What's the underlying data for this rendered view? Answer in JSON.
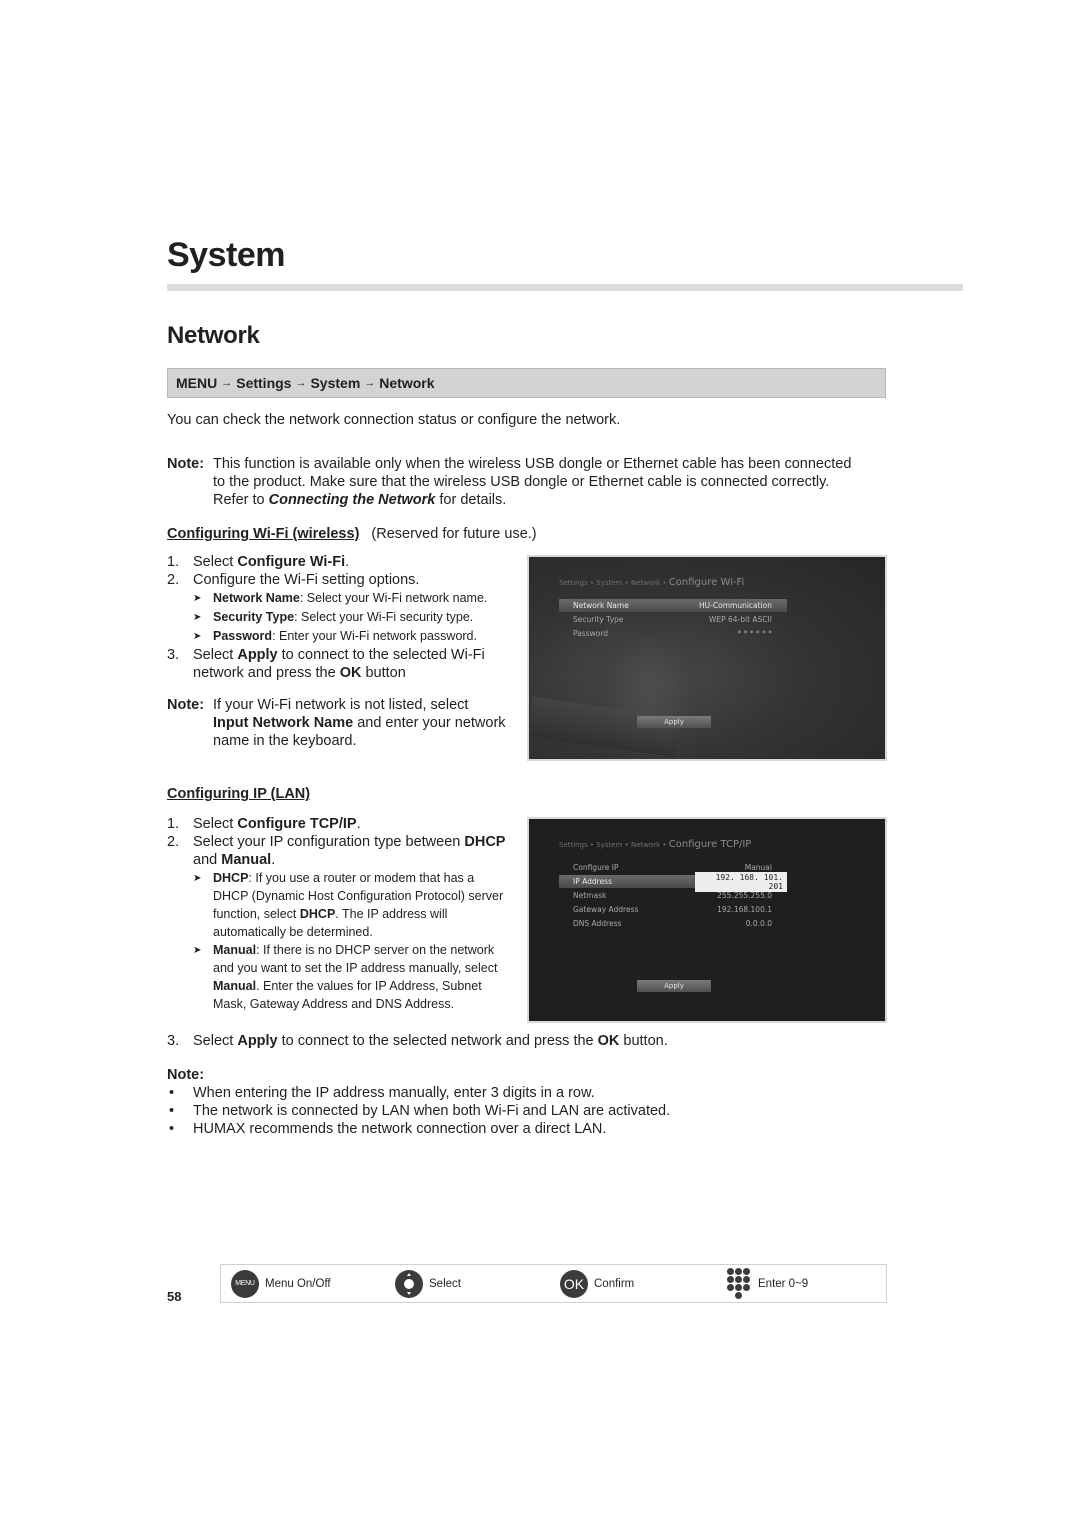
{
  "page": {
    "chapter_title": "System",
    "section_title": "Network",
    "page_number": "58"
  },
  "breadcrumb": {
    "items": [
      "MENU",
      "Settings",
      "System",
      "Network"
    ],
    "separator": "→"
  },
  "intro": "You can check the network connection status or configure the network.",
  "note1": {
    "label": "Note:",
    "line1": "This function is available only when the wireless USB dongle or Ethernet cable has been connected",
    "line2": "to the product. Make sure that the wireless USB dongle or Ethernet cable is connected correctly.",
    "line3_pre": "Refer to ",
    "line3_link": "Connecting the Network",
    "line3_post": " for details."
  },
  "wifi_section": {
    "heading": "Configuring Wi-Fi (wireless)",
    "heading_extra": "(Reserved for future use.)",
    "steps": [
      {
        "num": "1.",
        "pre": "Select ",
        "bold": "Configure Wi-Fi",
        "post": "."
      },
      {
        "num": "2.",
        "text": "Configure the Wi-Fi setting options."
      },
      {
        "num": "3.",
        "pre": "Select ",
        "bold": "Apply",
        "mid": " to connect to the selected Wi-Fi network and press the ",
        "bold2": "OK",
        "post": " button"
      }
    ],
    "bullets": [
      {
        "term": "Network Name",
        "desc": ": Select your Wi-Fi network name."
      },
      {
        "term": "Security Type",
        "desc": ": Select your Wi-Fi security type."
      },
      {
        "term": "Password",
        "desc": ": Enter your Wi-Fi network password."
      }
    ],
    "note": {
      "label": "Note:",
      "pre": "If your Wi-Fi network is not listed, select ",
      "bold": "Input Network Name",
      "post": " and enter your network name in the keyboard."
    },
    "screen": {
      "crumb": "Settings • System • Network •",
      "title": "Configure Wi-Fi",
      "rows": [
        {
          "label": "Network Name",
          "value": "HU-Communication"
        },
        {
          "label": "Security Type",
          "value": "WEP 64-bit ASCII"
        },
        {
          "label": "Password",
          "value": "* * * * * *"
        }
      ],
      "apply": "Apply"
    }
  },
  "lan_section": {
    "heading": "Configuring IP (LAN)",
    "steps": [
      {
        "num": "1.",
        "pre": "Select ",
        "bold": "Configure TCP/IP",
        "post": "."
      },
      {
        "num": "2.",
        "pre": "Select your IP configuration type between ",
        "bold": "DHCP",
        "mid": " and ",
        "bold2": "Manual",
        "post": "."
      },
      {
        "num": "3.",
        "pre": "Select ",
        "bold": "Apply",
        "mid": " to connect to the selected network and press the ",
        "bold2": "OK",
        "post": " button."
      }
    ],
    "bullets": [
      {
        "term": "DHCP",
        "desc": ": If you use a router or modem that has a DHCP (Dynamic Host Configuration Protocol) server function, select ",
        "term2": "DHCP",
        "desc2": ". The IP address will automatically be determined."
      },
      {
        "term": "Manual",
        "desc": ": If there is no DHCP server on the network and you want to set the IP address manually, select ",
        "term2": "Manual",
        "desc2": ". Enter the values for IP Address, Subnet Mask, Gateway Address and DNS Address."
      }
    ],
    "screen": {
      "crumb": "Settings • System • Network •",
      "title": "Configure TCP/IP",
      "rows": [
        {
          "label": "Configure IP",
          "value": "Manual"
        },
        {
          "label": "IP Address",
          "value": "192. 168. 101. 201"
        },
        {
          "label": "Netmask",
          "value": "255.255.255.0"
        },
        {
          "label": "Gateway Address",
          "value": "192.168.100.1"
        },
        {
          "label": "DNS Address",
          "value": "0.0.0.0"
        }
      ],
      "apply": "Apply"
    }
  },
  "final_note": {
    "label": "Note:",
    "items": [
      "When entering the IP address manually, enter 3 digits in a row.",
      "The network is connected by LAN when both Wi-Fi and LAN are activated.",
      "HUMAX recommends the network connection over a direct LAN."
    ]
  },
  "legend": {
    "items": [
      {
        "icon": "menu-button-icon",
        "icon_text": "MENU",
        "label": "Menu On/Off"
      },
      {
        "icon": "navigation-button-icon",
        "label": "Select"
      },
      {
        "icon": "ok-button-icon",
        "icon_text": "OK",
        "label": "Confirm"
      },
      {
        "icon": "number-keypad-icon",
        "label": "Enter 0~9"
      }
    ]
  }
}
